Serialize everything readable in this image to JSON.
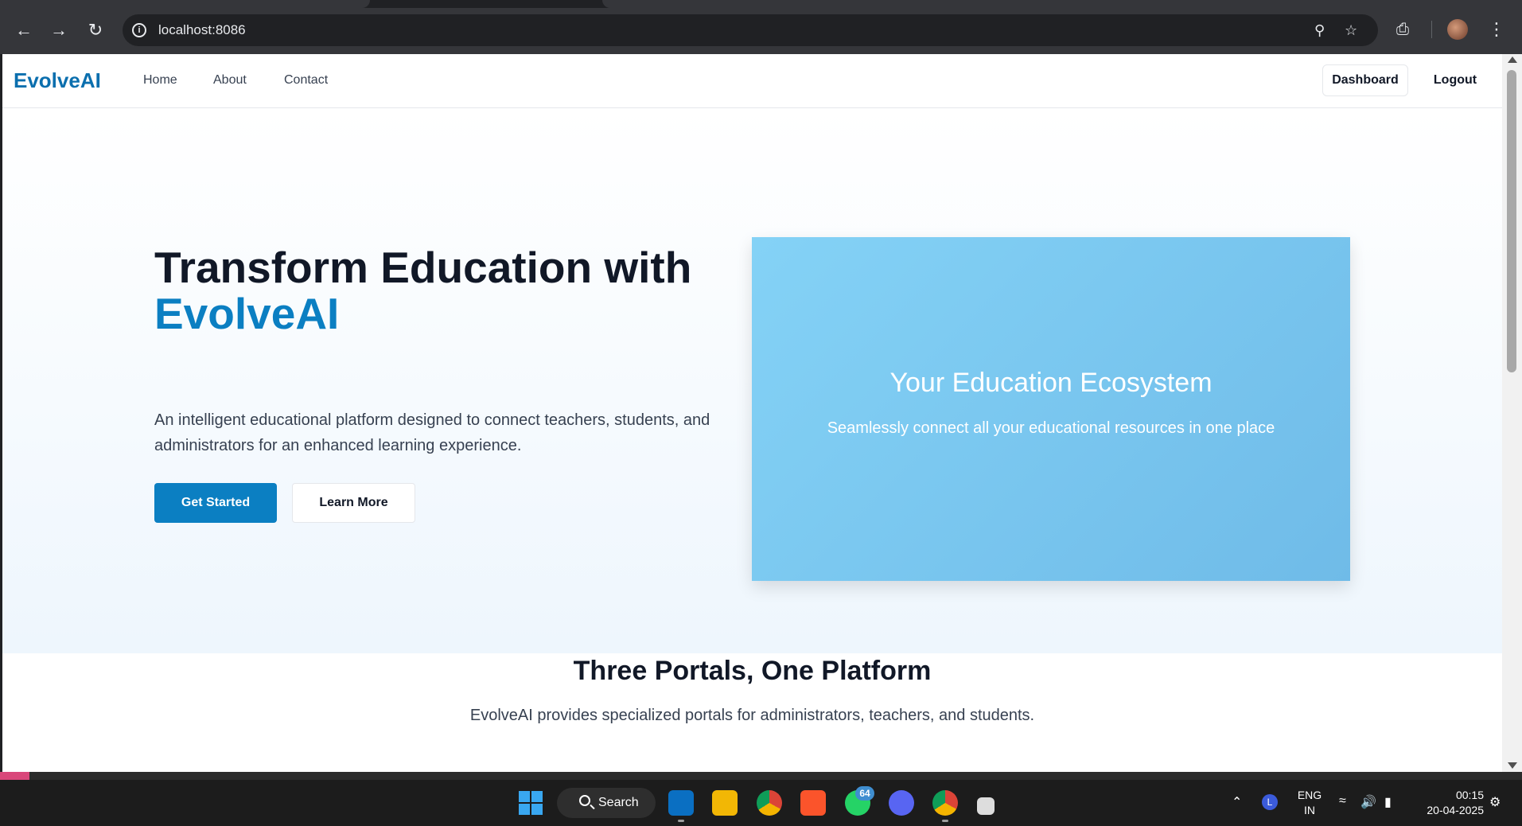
{
  "browser": {
    "url": "localhost:8086"
  },
  "site": {
    "brand": "EvolveAI",
    "nav": [
      "Home",
      "About",
      "Contact"
    ],
    "dashboard_label": "Dashboard",
    "logout_label": "Logout"
  },
  "hero": {
    "title_line1": "Transform Education with",
    "title_accent": "EvolveAI",
    "description": "An intelligent educational platform designed to connect teachers, students, and administrators for an enhanced learning experience.",
    "primary_cta": "Get Started",
    "secondary_cta": "Learn More",
    "card_title": "Your Education Ecosystem",
    "card_subtitle": "Seamlessly connect all your educational resources in one place"
  },
  "section": {
    "title": "Three Portals, One Platform",
    "subtitle": "EvolveAI provides specialized portals for administrators, teachers, and students."
  },
  "taskbar": {
    "search_label": "Search",
    "whatsapp_badge": "64",
    "lang_line1": "ENG",
    "lang_line2": "IN",
    "time": "00:15",
    "date": "20-04-2025"
  },
  "colors": {
    "brand": "#0b7fc2",
    "card_gradient_start": "#84d2f6",
    "card_gradient_end": "#6fbbe8"
  }
}
